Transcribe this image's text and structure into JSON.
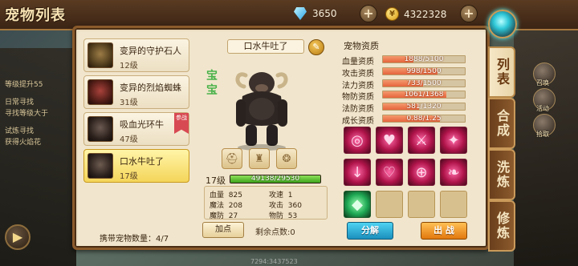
{
  "header": {
    "title": "宠物列表",
    "diamond_amount": "3650",
    "gold_amount": "4322328",
    "coin_symbol": "¥"
  },
  "pets": [
    {
      "name": "变异的守护石人",
      "level": "12级",
      "selected": false,
      "tag": ""
    },
    {
      "name": "变异的烈焰蜘蛛",
      "level": "31级",
      "selected": false,
      "tag": ""
    },
    {
      "name": "吸血光环牛",
      "level": "47级",
      "selected": false,
      "tag": "参战"
    },
    {
      "name": "口水牛吐了",
      "level": "17级",
      "selected": true,
      "tag": ""
    }
  ],
  "carry": {
    "label": "携带宠物数量：",
    "value": "4/7"
  },
  "detail": {
    "name": "口水牛吐了",
    "badge": "宝宝",
    "level": "17级",
    "exp_text": "49138/29530",
    "exp_fraction": 1.0,
    "stats": [
      {
        "label": "血量",
        "value": "825"
      },
      {
        "label": "攻速",
        "value": "1"
      },
      {
        "label": "魔法",
        "value": "208"
      },
      {
        "label": "攻击",
        "value": "360"
      },
      {
        "label": "魔防",
        "value": "27"
      },
      {
        "label": "物防",
        "value": "53"
      }
    ],
    "add_point_label": "加点",
    "remaining_label": "剩余点数:",
    "remaining_value": "0"
  },
  "aptitude": {
    "title": "宠物资质",
    "rows": [
      {
        "label": "血量资质",
        "text": "1888/5100",
        "fraction": 0.37
      },
      {
        "label": "攻击资质",
        "text": "998/1500",
        "fraction": 0.665
      },
      {
        "label": "法力资质",
        "text": "733/1500",
        "fraction": 0.49
      },
      {
        "label": "物防资质",
        "text": "1061/1368",
        "fraction": 0.776
      },
      {
        "label": "法防资质",
        "text": "581/1320",
        "fraction": 0.44
      },
      {
        "label": "成长资质",
        "text": "0.88/1.25",
        "fraction": 0.7
      }
    ]
  },
  "skills": [
    {
      "kind": "skill",
      "icon": "ring-skill-icon",
      "glyph": "◎"
    },
    {
      "kind": "skill",
      "icon": "heart-break-skill-icon",
      "glyph": "♥"
    },
    {
      "kind": "skill",
      "icon": "blade-skill-icon",
      "glyph": "⚔"
    },
    {
      "kind": "skill",
      "icon": "shield-flame-skill-icon",
      "glyph": "✦"
    },
    {
      "kind": "skill",
      "icon": "sword-down-skill-icon",
      "glyph": "↓"
    },
    {
      "kind": "skill",
      "icon": "heart-skill-icon",
      "glyph": "♡"
    },
    {
      "kind": "skill",
      "icon": "ring-plus-skill-icon",
      "glyph": "⊕"
    },
    {
      "kind": "skill",
      "icon": "wing-skill-icon",
      "glyph": "❧"
    },
    {
      "kind": "gem",
      "icon": "green-crystal-icon",
      "glyph": "◆"
    },
    {
      "kind": "empty",
      "icon": "",
      "glyph": ""
    },
    {
      "kind": "empty",
      "icon": "",
      "glyph": ""
    },
    {
      "kind": "empty",
      "icon": "",
      "glyph": ""
    }
  ],
  "buttons": {
    "split": "分解",
    "fight": "出 战"
  },
  "tabs": [
    {
      "label": "列表",
      "active": true
    },
    {
      "label": "合成",
      "active": false
    },
    {
      "label": "洗炼",
      "active": false
    },
    {
      "label": "修炼",
      "active": false
    }
  ],
  "background_quests": [
    "等级提升55",
    "日常寻找",
    "寻找等级大于",
    "试炼寻找",
    "获得火焰花"
  ],
  "side_labels": [
    "召唤",
    "活动",
    "拾取"
  ],
  "bottom_text": "7294:3437523"
}
